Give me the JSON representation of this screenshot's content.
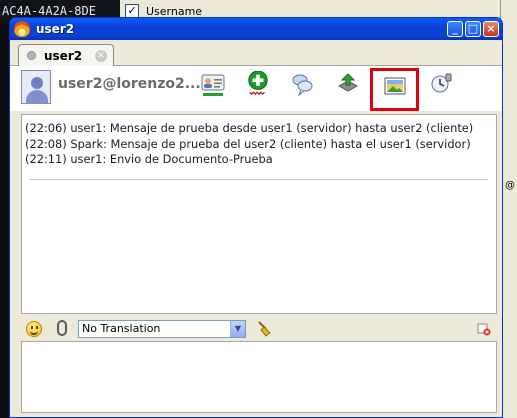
{
  "background": {
    "code_snippet": "AC4A-4A2A-8DE",
    "username_label": "Username",
    "edge_mark": "@"
  },
  "window": {
    "title": "user2",
    "controls": {
      "minimize": "_",
      "maximize": "□",
      "close": "×"
    }
  },
  "tab": {
    "label": "user2",
    "close": "×"
  },
  "header": {
    "user_name": "user2@lorenzo2...",
    "toolbar": [
      {
        "name": "vcard-icon"
      },
      {
        "name": "add-contact-icon"
      },
      {
        "name": "chat-history-icon"
      },
      {
        "name": "send-file-icon"
      },
      {
        "name": "screenshot-icon",
        "selected": true
      },
      {
        "name": "alarm-icon"
      }
    ]
  },
  "chat": {
    "messages": [
      "(22:06) user1: Mensaje de prueba desde user1 (servidor) hasta user2 (cliente)",
      "(22:08) Spark: Mensaje de prueba del user2 (cliente) hasta el user1 (servidor)",
      "(22:11) user1: Envio de Documento-Prueba"
    ]
  },
  "bottom_bar": {
    "translation_select": "No Translation",
    "dropdown_arrow": "▼"
  },
  "colors": {
    "title_bar": "#0a5ef7",
    "selection_box": "#e0000f",
    "window_bg": "#ece9d8"
  }
}
